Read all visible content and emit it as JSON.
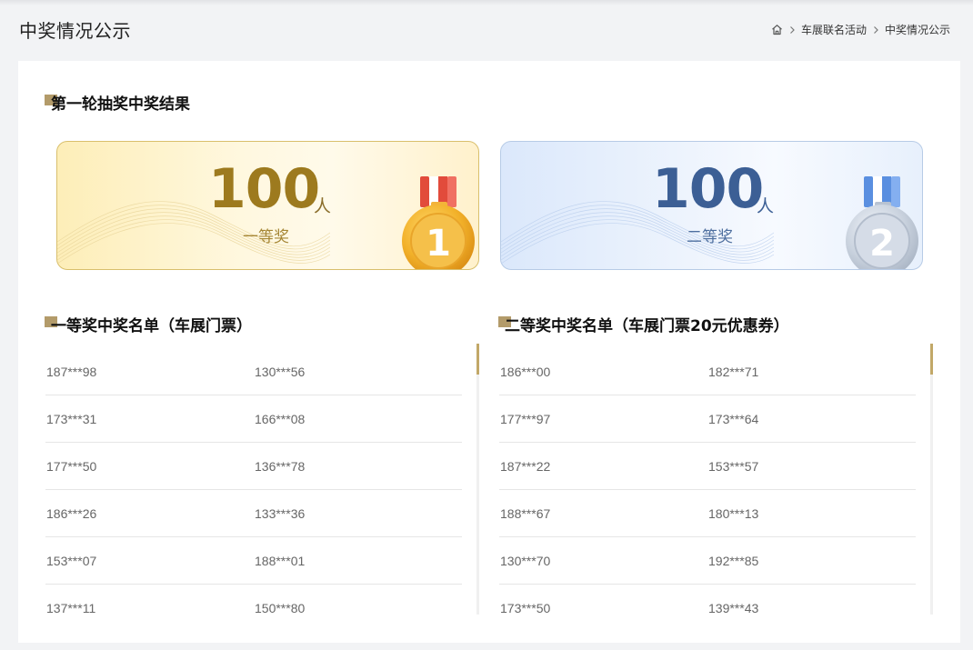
{
  "header": {
    "title": "中奖情况公示",
    "breadcrumb": [
      "车展联名活动",
      "中奖情况公示"
    ]
  },
  "round": {
    "title": "第一轮抽奖中奖结果"
  },
  "prizes": [
    {
      "count": "100",
      "unit": "人",
      "label": "一等奖",
      "medal": "1"
    },
    {
      "count": "100",
      "unit": "人",
      "label": "二等奖",
      "medal": "2"
    }
  ],
  "lists": [
    {
      "title": "一等奖中奖名单（车展门票）",
      "rows": [
        [
          "187***98",
          "130***56"
        ],
        [
          "173***31",
          "166***08"
        ],
        [
          "177***50",
          "136***78"
        ],
        [
          "186***26",
          "133***36"
        ],
        [
          "153***07",
          "188***01"
        ],
        [
          "137***11",
          "150***80"
        ]
      ]
    },
    {
      "title": "二等奖中奖名单（车展门票20元优惠券）",
      "rows": [
        [
          "186***00",
          "182***71"
        ],
        [
          "177***97",
          "173***64"
        ],
        [
          "187***22",
          "153***57"
        ],
        [
          "188***67",
          "180***13"
        ],
        [
          "130***70",
          "192***85"
        ],
        [
          "173***50",
          "139***43"
        ]
      ]
    }
  ],
  "icons": {
    "breadcrumb_home": "home-icon",
    "breadcrumb_separator": "chevron-right-icon",
    "medal_gold": "gold-medal-icon",
    "medal_silver": "silver-medal-icon"
  },
  "colors": {
    "accent": "#b39b6a",
    "gold_text": "#9d7a1e",
    "silver_text": "#3c5f95",
    "gold_border": "#d9bf6c",
    "silver_border": "#b7cbe6"
  }
}
